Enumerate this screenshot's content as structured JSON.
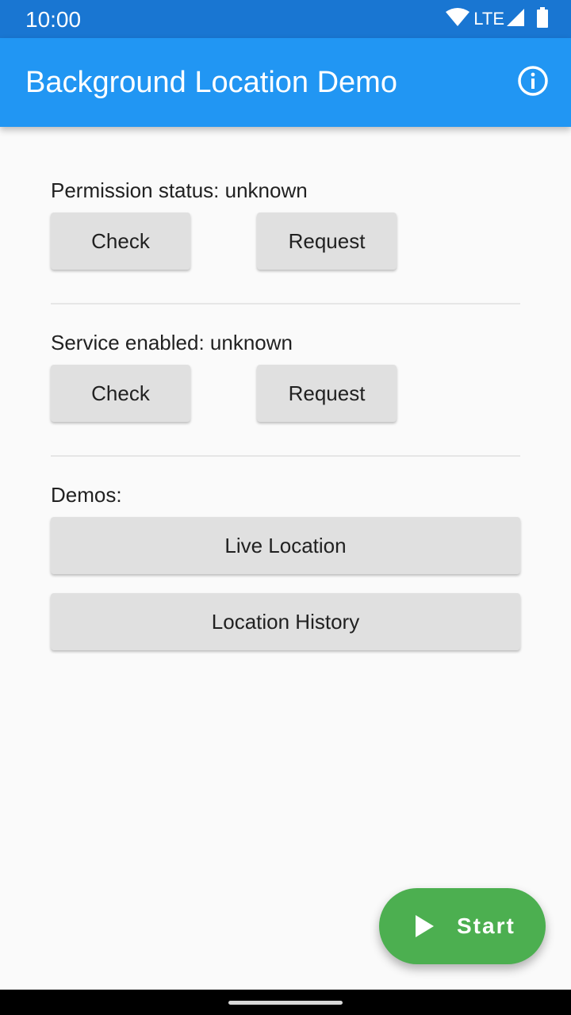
{
  "status_bar": {
    "time": "10:00",
    "network": "LTE",
    "icons": [
      "wifi-icon",
      "signal-icon",
      "battery-icon"
    ]
  },
  "app_bar": {
    "title": "Background Location Demo",
    "action_icon": "info-icon"
  },
  "permission": {
    "label": "Permission status: unknown",
    "check_label": "Check",
    "request_label": "Request"
  },
  "service": {
    "label": "Service enabled: unknown",
    "check_label": "Check",
    "request_label": "Request"
  },
  "demos": {
    "label": "Demos:",
    "items": [
      {
        "label": "Live Location"
      },
      {
        "label": "Location History"
      }
    ]
  },
  "fab": {
    "label": "Start",
    "icon": "play-icon"
  },
  "colors": {
    "status_bar": "#1976d2",
    "app_bar": "#2196f3",
    "background": "#fafafa",
    "button": "#e0e0e0",
    "fab": "#4caf50"
  }
}
